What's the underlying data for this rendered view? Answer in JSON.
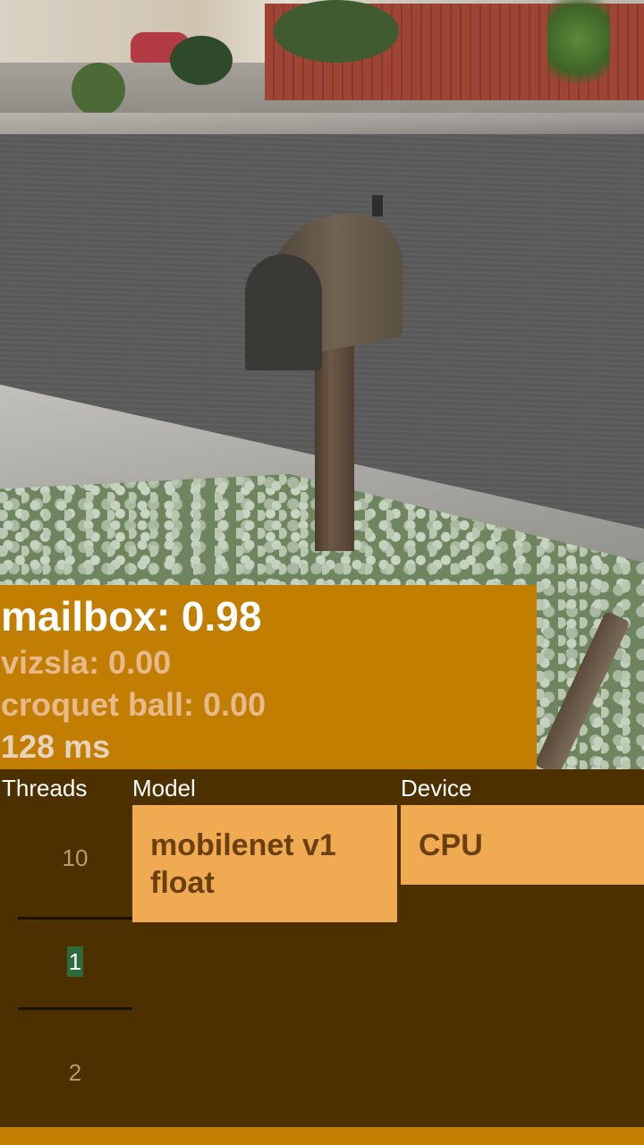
{
  "results": {
    "top": "mailbox: 0.98",
    "second": "vizsla: 0.00",
    "third": "croquet ball: 0.00",
    "latency": "128 ms"
  },
  "controls": {
    "threads_label": "Threads",
    "model_label": "Model",
    "device_label": "Device",
    "threads_options": [
      "10",
      "1",
      "2"
    ],
    "threads_selected": "1",
    "model_value": "mobilenet v1 float",
    "device_value": "CPU"
  },
  "colors": {
    "results_background": "#c17e00",
    "panel_background": "#4d3000",
    "selector_background": "#f0aa52",
    "selected_highlight": "#2e6b3c"
  }
}
